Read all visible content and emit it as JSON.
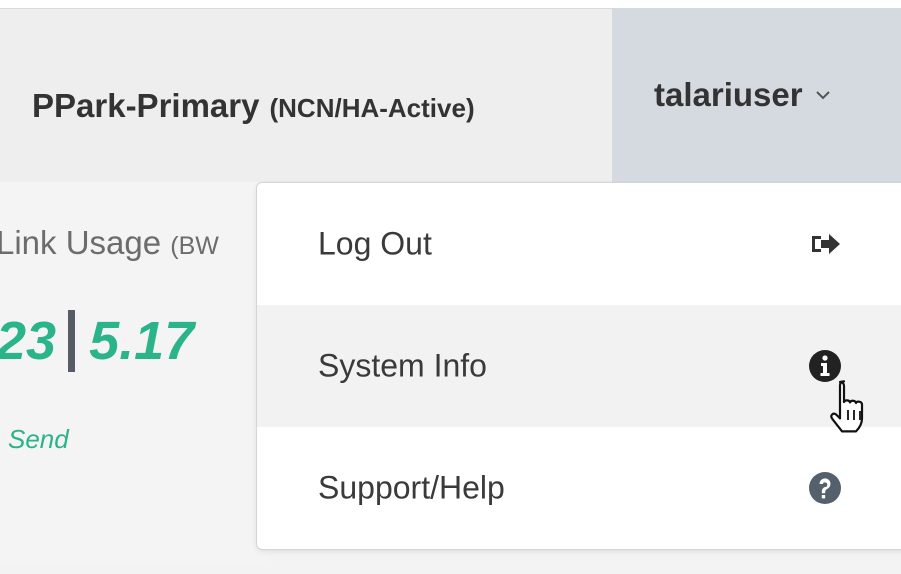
{
  "header": {
    "device_name": "PPark-Primary",
    "device_status": "(NCN/HA-Active)",
    "user_label": "talariuser"
  },
  "content": {
    "link_usage_label": "Link Usage",
    "link_usage_unit": "(BW",
    "value_left": "23",
    "value_right": "5.17",
    "send_label": "Send"
  },
  "dropdown": {
    "items": [
      {
        "label": "Log Out",
        "icon": "sign-out-icon"
      },
      {
        "label": "System Info",
        "icon": "info-circle-icon"
      },
      {
        "label": "Support/Help",
        "icon": "question-circle-icon"
      }
    ],
    "hovered_item": "System Info"
  },
  "colors": {
    "header_bg": "#eeeeee",
    "user_menu_bg": "#d5dae1",
    "accent_green": "#2bb38a",
    "icon_dark": "#333333",
    "icon_help": "#55606d"
  }
}
